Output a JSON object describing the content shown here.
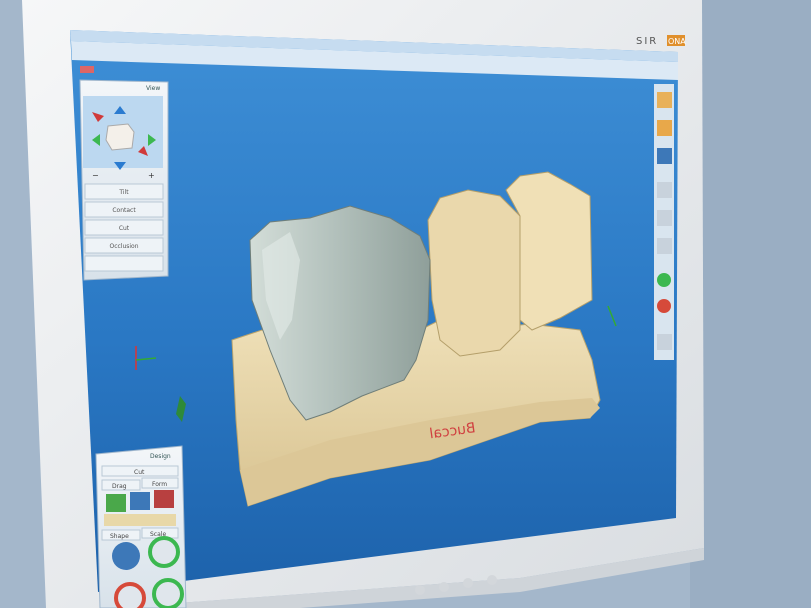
{
  "monitor": {
    "brand": "SIRONA",
    "brand_prefix": "SIR",
    "brand_suffix": "ONA"
  },
  "view_panel": {
    "title": "View",
    "zoom_out": "−",
    "zoom_in": "+",
    "buttons": [
      "Tilt",
      "Contact",
      "Cut",
      "Occlusion",
      ""
    ]
  },
  "model": {
    "annotation": "Buccal"
  },
  "design_panel": {
    "title": "Design",
    "header_text": "Cut",
    "tab_left": "Drag",
    "tab_right": "Form",
    "subtab_left": "Shape",
    "subtab_right": "Scale"
  },
  "colors": {
    "screen_bg_top": "#2f7fc8",
    "screen_bg_bottom": "#1c5fa6",
    "die_stone": "#e6d3a6",
    "crown": "#b9c6c1",
    "monitor_bezel": "#ebedef"
  }
}
